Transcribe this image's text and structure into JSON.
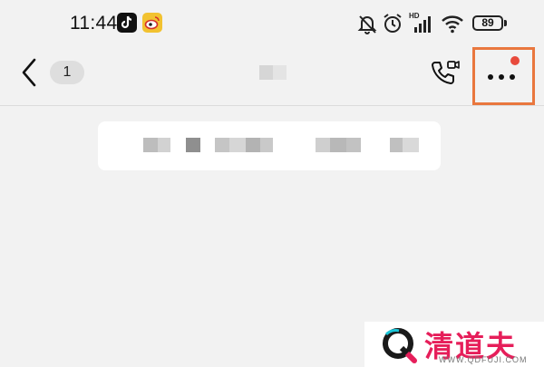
{
  "status_bar": {
    "time": "11:44",
    "battery": "89",
    "icons": [
      "tiktok-icon",
      "weibo-icon",
      "mute-bell-icon",
      "alarm-icon",
      "hd-signal-icon",
      "wifi-icon",
      "battery-icon"
    ]
  },
  "nav": {
    "back_icon": "chevron-left-icon",
    "unread_count": "1",
    "call_icon": "video-call-icon",
    "more_icon": "more-dots-icon",
    "more_has_notification": true
  },
  "colors": {
    "background": "#f2f2f2",
    "highlight": "#e9773e",
    "notification_dot": "#e84a3c",
    "watermark_text": "#e61e5a"
  },
  "watermark": {
    "brand": "清道夫",
    "url": "WWW.QDFUJI.COM"
  }
}
